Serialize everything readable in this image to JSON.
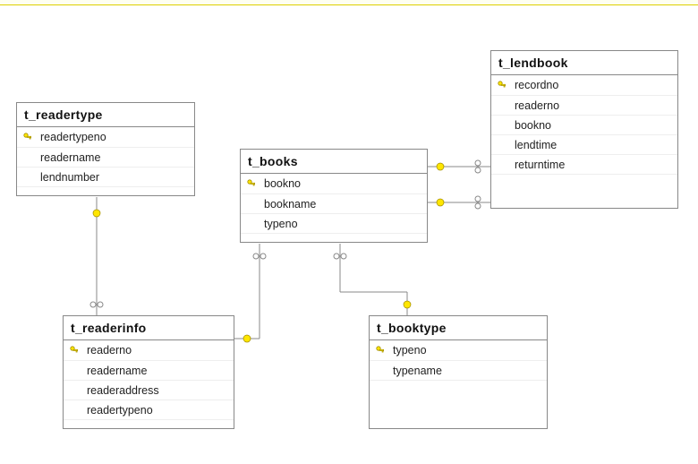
{
  "entities": {
    "readertype": {
      "title": "t_readertype",
      "columns": [
        {
          "name": "readertypeno",
          "pk": true
        },
        {
          "name": "readername",
          "pk": false
        },
        {
          "name": "lendnumber",
          "pk": false
        }
      ]
    },
    "books": {
      "title": "t_books",
      "columns": [
        {
          "name": "bookno",
          "pk": true
        },
        {
          "name": "bookname",
          "pk": false
        },
        {
          "name": "typeno",
          "pk": false
        }
      ]
    },
    "lendbook": {
      "title": "t_lendbook",
      "columns": [
        {
          "name": "recordno",
          "pk": true
        },
        {
          "name": "readerno",
          "pk": false
        },
        {
          "name": "bookno",
          "pk": false
        },
        {
          "name": "lendtime",
          "pk": false
        },
        {
          "name": "returntime",
          "pk": false
        }
      ]
    },
    "readerinfo": {
      "title": "t_readerinfo",
      "columns": [
        {
          "name": "readerno",
          "pk": true
        },
        {
          "name": "readername",
          "pk": false
        },
        {
          "name": "readeraddress",
          "pk": false
        },
        {
          "name": "readertypeno",
          "pk": false
        }
      ]
    },
    "booktype": {
      "title": "t_booktype",
      "columns": [
        {
          "name": "typeno",
          "pk": true
        },
        {
          "name": "typename",
          "pk": false
        }
      ]
    }
  },
  "relationships": [
    {
      "from": "readertype",
      "from_col": "readertypeno",
      "to": "readerinfo",
      "to_col": "readertypeno"
    },
    {
      "from": "readerinfo",
      "from_col": "readerno",
      "to": "books",
      "to_col": null,
      "via": "lendbook"
    },
    {
      "from": "books",
      "from_col": "bookno",
      "to": "lendbook",
      "to_col": "bookno"
    },
    {
      "from": "readerinfo",
      "from_col": "readerno",
      "to": "lendbook",
      "to_col": "readerno"
    },
    {
      "from": "booktype",
      "from_col": "typeno",
      "to": "books",
      "to_col": "typeno"
    }
  ]
}
